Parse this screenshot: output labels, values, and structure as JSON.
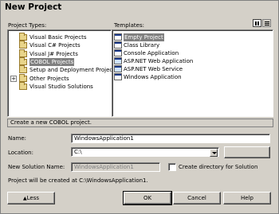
{
  "dialog": {
    "title": "New Project",
    "project_types_label": "Project Types:",
    "templates_label": "Templates:"
  },
  "project_types": [
    {
      "label": "Visual Basic Projects",
      "expandable": false,
      "selected": false
    },
    {
      "label": "Visual C# Projects",
      "expandable": false,
      "selected": false
    },
    {
      "label": "Visual J# Projects",
      "expandable": false,
      "selected": false
    },
    {
      "label": "COBOL Projects",
      "expandable": false,
      "selected": true
    },
    {
      "label": "Setup and Deployment Projects",
      "expandable": false,
      "selected": false
    },
    {
      "label": "Other Projects",
      "expandable": true,
      "selected": false
    },
    {
      "label": "Visual Studio Solutions",
      "expandable": false,
      "selected": false
    }
  ],
  "templates": [
    {
      "label": "Empty Project",
      "icon": "empty-project-icon",
      "selected": true
    },
    {
      "label": "Class Library",
      "icon": "class-library-icon",
      "selected": false
    },
    {
      "label": "Console Application",
      "icon": "console-application-icon",
      "selected": false
    },
    {
      "label": "ASP.NET Web Application",
      "icon": "web-application-icon",
      "selected": false
    },
    {
      "label": "ASP.NET Web Service",
      "icon": "web-service-icon",
      "selected": false
    },
    {
      "label": "Windows Application",
      "icon": "windows-application-icon",
      "selected": false
    }
  ],
  "description": "Create a new COBOL project.",
  "form": {
    "name_label": "Name:",
    "name_value": "WindowsApplication1",
    "location_label": "Location:",
    "location_value": "C:\\",
    "browse_label": "Browse...",
    "solution_label": "New Solution Name:",
    "solution_value": "WindowsApplication1",
    "create_dir_label": "Create directory for Solution",
    "create_dir_checked": false,
    "created_at": "Project will be created at C:\\WindowsApplication1."
  },
  "buttons": {
    "less": "Less",
    "ok": "OK",
    "cancel": "Cancel",
    "help": "Help"
  },
  "colors": {
    "dialog_bg": "#d4d0c8",
    "selection": "#808080"
  }
}
